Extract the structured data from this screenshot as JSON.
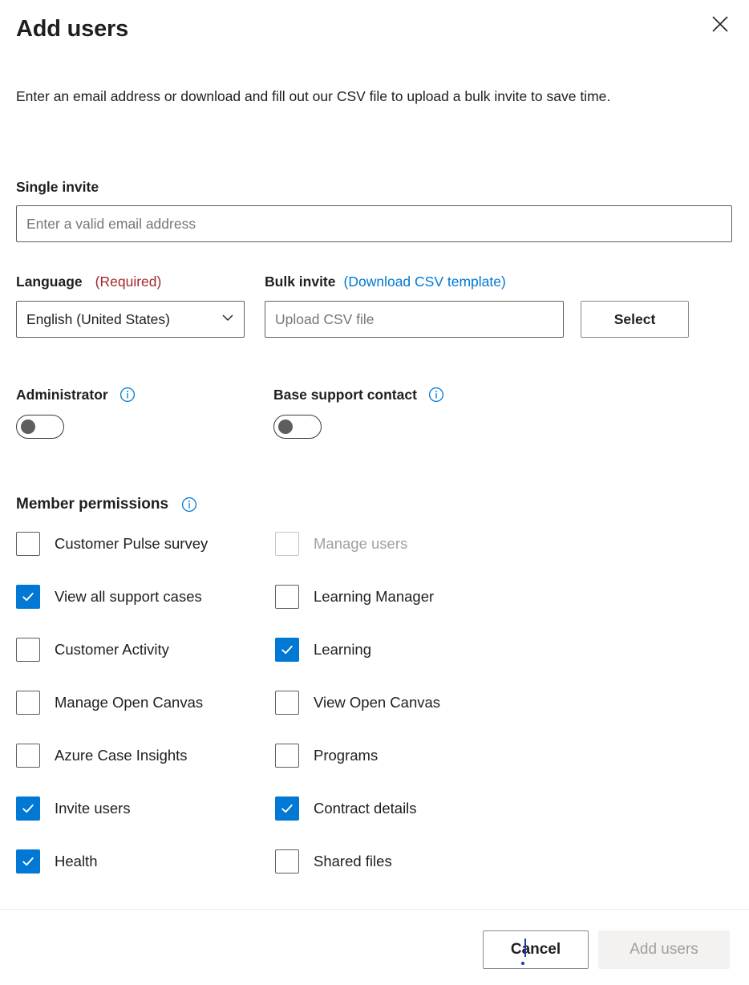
{
  "header": {
    "title": "Add users",
    "close_icon": "close-icon"
  },
  "intro": {
    "text": "Enter an email address or download and fill out our CSV file to upload a bulk invite to save time."
  },
  "single_invite": {
    "label": "Single invite",
    "placeholder": "Enter a valid email address",
    "value": ""
  },
  "language": {
    "label": "Language",
    "required_text": "(Required)",
    "selected": "English (United States)",
    "chevron_icon": "chevron-down-icon"
  },
  "bulk_invite": {
    "label": "Bulk invite",
    "link_text": "(Download CSV template)",
    "placeholder": "Upload CSV file",
    "value": "",
    "select_button": "Select"
  },
  "toggles": [
    {
      "label": "Administrator",
      "state": "off",
      "info_icon": "info-icon"
    },
    {
      "label": "Base support contact",
      "state": "off",
      "info_icon": "info-icon"
    }
  ],
  "member_permissions": {
    "heading": "Member permissions",
    "info_icon": "info-icon",
    "left_column": [
      {
        "label": "Customer Pulse survey",
        "checked": false,
        "disabled": false
      },
      {
        "label": "View all support cases",
        "checked": true,
        "disabled": false
      },
      {
        "label": "Customer Activity",
        "checked": false,
        "disabled": false
      },
      {
        "label": "Manage Open Canvas",
        "checked": false,
        "disabled": false
      },
      {
        "label": "Azure Case Insights",
        "checked": false,
        "disabled": false
      },
      {
        "label": "Invite users",
        "checked": true,
        "disabled": false
      },
      {
        "label": "Health",
        "checked": true,
        "disabled": false
      }
    ],
    "right_column": [
      {
        "label": "Manage users",
        "checked": false,
        "disabled": true
      },
      {
        "label": "Learning Manager",
        "checked": false,
        "disabled": false
      },
      {
        "label": "Learning",
        "checked": true,
        "disabled": false
      },
      {
        "label": "View Open Canvas",
        "checked": false,
        "disabled": false
      },
      {
        "label": "Programs",
        "checked": false,
        "disabled": false
      },
      {
        "label": "Contract details",
        "checked": true,
        "disabled": false
      },
      {
        "label": "Shared files",
        "checked": false,
        "disabled": false
      }
    ]
  },
  "footer": {
    "cancel_label": "Cancel",
    "submit_label": "Add users",
    "submit_disabled": true
  },
  "colors": {
    "accent": "#0078d4",
    "required": "#a4262c",
    "text": "#201f1e",
    "disabled_text": "#a19f9d",
    "border": "#605e5c",
    "divider": "#edebe9"
  }
}
